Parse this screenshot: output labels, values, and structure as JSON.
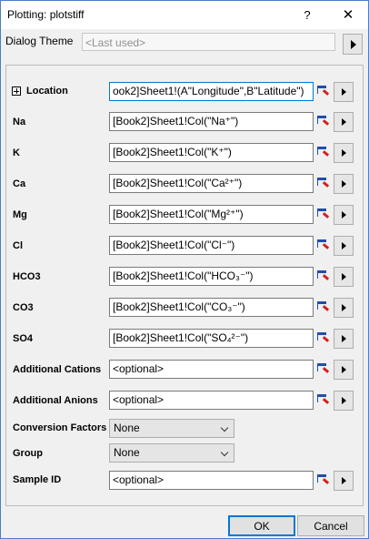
{
  "window": {
    "title": "Plotting: plotstiff",
    "help_symbol": "?",
    "close_symbol": "✕"
  },
  "theme": {
    "label": "Dialog Theme",
    "value": "<Last used>"
  },
  "rows": [
    {
      "label": "Location",
      "value": "ook2]Sheet1!(A\"Longitude\",B\"Latitude\")"
    },
    {
      "label": "Na",
      "value": "[Book2]Sheet1!Col(\"Na⁺\")"
    },
    {
      "label": "K",
      "value": "[Book2]Sheet1!Col(\"K⁺\")"
    },
    {
      "label": "Ca",
      "value": "[Book2]Sheet1!Col(\"Ca²⁺\")"
    },
    {
      "label": "Mg",
      "value": "[Book2]Sheet1!Col(\"Mg²⁺\")"
    },
    {
      "label": "Cl",
      "value": "[Book2]Sheet1!Col(\"Cl⁻\")"
    },
    {
      "label": "HCO3",
      "value": "[Book2]Sheet1!Col(\"HCO₃⁻\")"
    },
    {
      "label": "CO3",
      "value": "[Book2]Sheet1!Col(\"CO₃⁻\")"
    },
    {
      "label": "SO4",
      "value": "[Book2]Sheet1!Col(\"SO₄²⁻\")"
    },
    {
      "label": "Additional Cations",
      "value": "<optional>"
    },
    {
      "label": "Additional Anions",
      "value": "<optional>"
    }
  ],
  "conversion": {
    "label": "Conversion Factors",
    "value": "None"
  },
  "group": {
    "label": "Group",
    "value": "None"
  },
  "sample": {
    "label": "Sample ID",
    "value": "<optional>"
  },
  "buttons": {
    "ok": "OK",
    "cancel": "Cancel"
  }
}
